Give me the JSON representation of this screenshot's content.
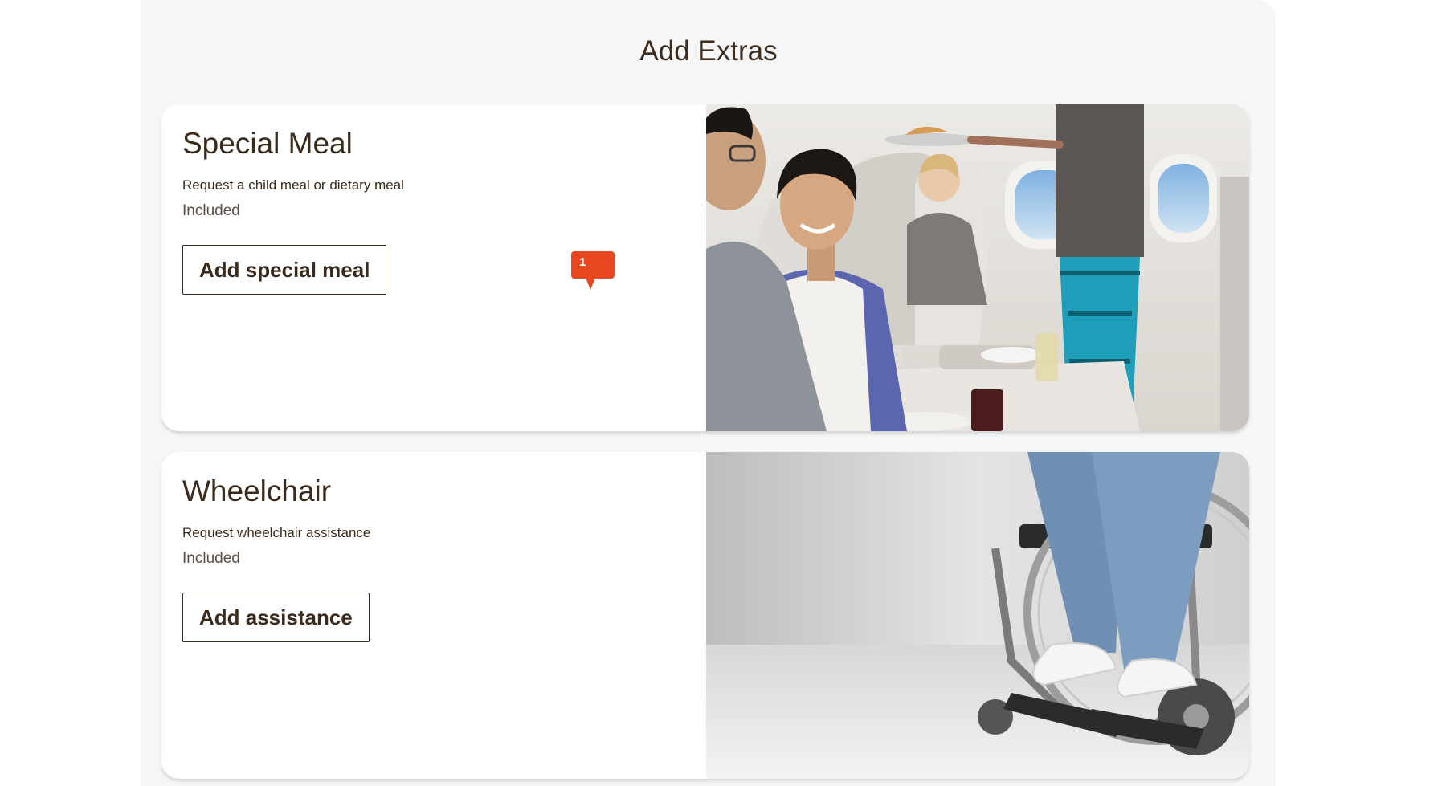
{
  "page": {
    "title": "Add Extras"
  },
  "extras": [
    {
      "title": "Special Meal",
      "description": "Request a child meal or dietary meal",
      "price": "Included",
      "button_label": "Add special meal",
      "badge_count": "1"
    },
    {
      "title": "Wheelchair",
      "description": "Request wheelchair assistance",
      "price": "Included",
      "button_label": "Add assistance"
    }
  ],
  "colors": {
    "text": "#3a2a1c",
    "badge": "#e8481f",
    "panel": "#f6f6f6"
  }
}
